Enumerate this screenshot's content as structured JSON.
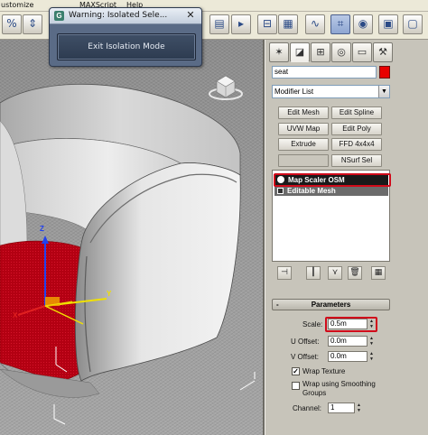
{
  "menubar": {
    "items": [
      "ustomize",
      "MAXScript",
      "Help"
    ]
  },
  "toolbar": {
    "buttons": [
      {
        "icon": "percent-snap-icon",
        "glyph": "%"
      },
      {
        "icon": "spinner-snap-icon",
        "glyph": "⇕"
      },
      {
        "icon": "named-selection-icon",
        "glyph": "▤"
      },
      {
        "icon": "mirror-icon",
        "glyph": "▸"
      },
      {
        "icon": "align-icon",
        "glyph": "⊟"
      },
      {
        "icon": "layer-manager-icon",
        "glyph": "▦"
      },
      {
        "icon": "curve-editor-icon",
        "glyph": "∿"
      },
      {
        "icon": "schematic-view-icon",
        "glyph": "⌗"
      },
      {
        "icon": "material-editor-icon",
        "glyph": "◉"
      },
      {
        "icon": "render-setup-icon",
        "glyph": "▣"
      },
      {
        "icon": "render-frame-icon",
        "glyph": "▢"
      },
      {
        "icon": "quick-render-icon",
        "glyph": "☕"
      }
    ]
  },
  "warning_dialog": {
    "title": "Warning: Isolated Sele...",
    "close_glyph": "✕",
    "icon_glyph": "G",
    "exit_button": "Exit Isolation Mode"
  },
  "command_panel": {
    "tabs": [
      {
        "icon": "create-tab-icon",
        "glyph": "✶"
      },
      {
        "icon": "modify-tab-icon",
        "glyph": "◪"
      },
      {
        "icon": "hierarchy-tab-icon",
        "glyph": "⊞"
      },
      {
        "icon": "motion-tab-icon",
        "glyph": "◎"
      },
      {
        "icon": "display-tab-icon",
        "glyph": "▭"
      },
      {
        "icon": "utilities-tab-icon",
        "glyph": "⚒"
      }
    ],
    "object_name": "seat",
    "object_color": "#e80000",
    "modifier_list": "Modifier List",
    "modifier_buttons": [
      [
        "Edit Mesh",
        "Edit Spline"
      ],
      [
        "UVW Map",
        "Edit Poly"
      ],
      [
        "Extrude",
        "FFD 4x4x4"
      ],
      [
        "",
        "NSurf Sel"
      ]
    ],
    "stack_items": [
      "Map Scaler OSM",
      "Editable Mesh"
    ],
    "stack_tools": [
      {
        "icon": "pin-stack-icon",
        "glyph": "⊣"
      },
      {
        "icon": "show-end-result-icon",
        "glyph": "┃"
      },
      {
        "icon": "make-unique-icon",
        "glyph": "⋎"
      },
      {
        "icon": "remove-modifier-icon",
        "glyph": "🗑"
      },
      {
        "icon": "configure-sets-icon",
        "glyph": "▦"
      }
    ],
    "parameters": {
      "rollout_title": "Parameters",
      "collapse_glyph": "-",
      "scale_label": "Scale:",
      "scale_value": "0.5m",
      "u_offset_label": "U Offset:",
      "u_offset_value": "0.0m",
      "v_offset_label": "V Offset:",
      "v_offset_value": "0.0m",
      "wrap_texture_label": "Wrap Texture",
      "wrap_texture_checked": true,
      "wrap_smoothing_label_1": "Wrap using Smoothing",
      "wrap_smoothing_label_2": "Groups",
      "wrap_smoothing_checked": false,
      "channel_label": "Channel:",
      "channel_value": "1"
    }
  },
  "viewport": {
    "gizmo_labels": {
      "x": "X",
      "y": "Y",
      "z": "Z"
    }
  },
  "colors": {
    "highlight_red": "#d10a1a",
    "gizmo_x": "#e02020",
    "gizmo_y": "#f0e000",
    "gizmo_z": "#2040f0",
    "cushion": "#b80010"
  }
}
